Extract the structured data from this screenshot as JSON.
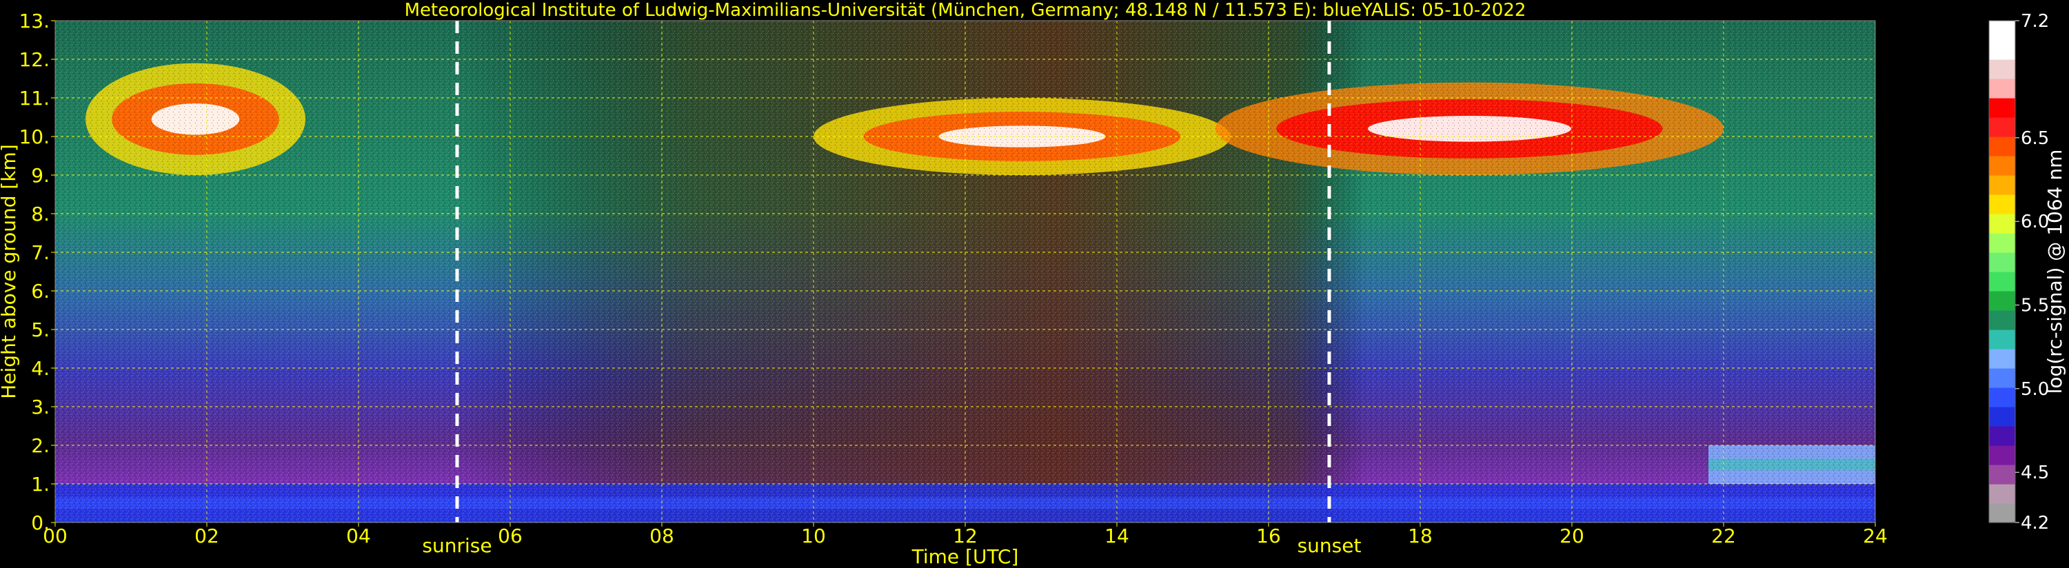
{
  "chart_data": {
    "type": "heatmap",
    "title": "Meteorological Institute of Ludwig-Maximilians-Universität (München, Germany; 48.148 N / 11.573 E):     blueYALIS: 05-10-2022",
    "xlabel": "Time [UTC]",
    "ylabel": "Height above ground [km]",
    "xlim": [
      0,
      24
    ],
    "ylim": [
      0,
      13
    ],
    "x_ticks": [
      "00",
      "02",
      "04",
      "06",
      "08",
      "10",
      "12",
      "14",
      "16",
      "18",
      "20",
      "22",
      "24"
    ],
    "x_tick_values": [
      0,
      2,
      4,
      6,
      8,
      10,
      12,
      14,
      16,
      18,
      20,
      22,
      24
    ],
    "y_ticks": [
      "0.",
      "1.",
      "2.",
      "3.",
      "4.",
      "5.",
      "6.",
      "7.",
      "8.",
      "9.",
      "10.",
      "11.",
      "12.",
      "13."
    ],
    "y_tick_values": [
      0,
      1,
      2,
      3,
      4,
      5,
      6,
      7,
      8,
      9,
      10,
      11,
      12,
      13
    ],
    "grid": true,
    "grid_color": "#ffff00",
    "text_color": "#ffff00",
    "annotations": [
      {
        "label": "sunrise",
        "x": 5.3
      },
      {
        "label": "sunset",
        "x": 16.8
      }
    ],
    "colorbar": {
      "label": "log(rc-signal) @ 1064 nm",
      "range": [
        4.2,
        7.2
      ],
      "ticks": [
        "4.2",
        "4.5",
        "5.0",
        "5.5",
        "6.0",
        "6.5",
        "7.2"
      ],
      "tick_values": [
        4.2,
        4.5,
        5.0,
        5.5,
        6.0,
        6.5,
        7.2
      ],
      "colors": [
        "#a0a0a0",
        "#b89ab0",
        "#9a4aa0",
        "#7a1aa0",
        "#4a10b0",
        "#2030e0",
        "#3050ff",
        "#5080ff",
        "#80b0ff",
        "#30c0b0",
        "#209060",
        "#20b040",
        "#40e060",
        "#70f070",
        "#a0ff60",
        "#e0ff30",
        "#ffe000",
        "#ffb000",
        "#ff8000",
        "#ff5000",
        "#ff2020",
        "#ff0000",
        "#ffb0b0",
        "#f0d0d0",
        "#ffffff",
        "#ffffff"
      ]
    },
    "features": [
      {
        "name": "cirrus cloud",
        "x_range": [
          0.4,
          3.3
        ],
        "y_range": [
          9.0,
          11.9
        ],
        "max_value": 7.0
      },
      {
        "name": "cirrus cloud",
        "x_range": [
          10.0,
          15.5
        ],
        "y_range": [
          9.0,
          11.0
        ],
        "max_value": 7.0
      },
      {
        "name": "cirrus cloud",
        "x_range": [
          15.3,
          22.0
        ],
        "y_range": [
          9.0,
          11.4
        ],
        "max_value": 7.2
      },
      {
        "name": "boundary layer",
        "x_range": [
          0,
          24
        ],
        "y_range": [
          0,
          1.0
        ],
        "max_value": 5.0
      },
      {
        "name": "residual layer",
        "x_range": [
          21.8,
          24
        ],
        "y_range": [
          1.0,
          2.0
        ],
        "max_value": 5.3
      }
    ]
  }
}
